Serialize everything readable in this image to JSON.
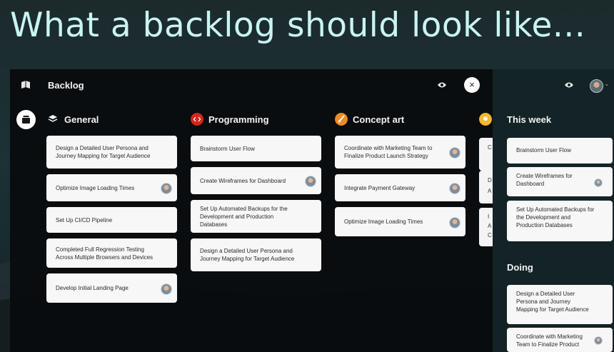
{
  "headline": "What a backlog should look like...",
  "app": {
    "title": "Backlog",
    "close_label": "×",
    "columns": [
      {
        "title": "General",
        "icon": "layers-icon",
        "icon_color": "#ffffff",
        "cards": [
          {
            "text": "Design a Detailed User Persona and Journey Mapping for Target Audience",
            "avatar": false
          },
          {
            "text": "Optimize Image Loading Times",
            "avatar": true
          },
          {
            "text": "Set Up CI/CD Pipeline",
            "avatar": false
          },
          {
            "text": "Completed Full Regression Testing Across Multiple Browsers and Devices",
            "avatar": false
          },
          {
            "text": "Develop Initial Landing Page",
            "avatar": true
          }
        ]
      },
      {
        "title": "Programming",
        "icon": "code-icon",
        "icon_color": "#d6261c",
        "cards": [
          {
            "text": "Brainstorm User Flow",
            "avatar": false
          },
          {
            "text": "Create Wireframes for Dashboard",
            "avatar": true
          },
          {
            "text": "Set Up Automated Backups for the Development and Production Databases",
            "avatar": false
          },
          {
            "text": "Design a Detailed User Persona and Journey Mapping for Target Audience",
            "avatar": false
          }
        ]
      },
      {
        "title": "Concept art",
        "icon": "brush-icon",
        "icon_color": "#f08a24",
        "cards": [
          {
            "text": "Coordinate with Marketing Team to Finalize Product Launch Strategy",
            "avatar": true
          },
          {
            "text": "Integrate Payment Gateway",
            "avatar": true
          },
          {
            "text": "Optimize Image Loading Times",
            "avatar": true
          }
        ]
      }
    ],
    "peek_column": {
      "icon": "bulb-icon",
      "icon_color": "#f5b82e",
      "card_letters": [
        "C",
        "D\nA",
        "I\nA\nC"
      ]
    }
  },
  "right_panel": {
    "sections": [
      {
        "title": "This week",
        "cards": [
          {
            "text": "Brainstorm User Flow",
            "avatar": false
          },
          {
            "text": "Create Wireframes for Dashboard",
            "avatar": true
          },
          {
            "text": "Set Up Automated Backups for the Development and Production Databases",
            "avatar": false
          }
        ]
      },
      {
        "title": "Doing",
        "cards": [
          {
            "text": "Design a Detailed User Persona and Journey Mapping for Target Audience",
            "avatar": false
          },
          {
            "text": "Coordinate with Marketing Team to Finalize Product",
            "avatar": true
          }
        ]
      }
    ]
  }
}
